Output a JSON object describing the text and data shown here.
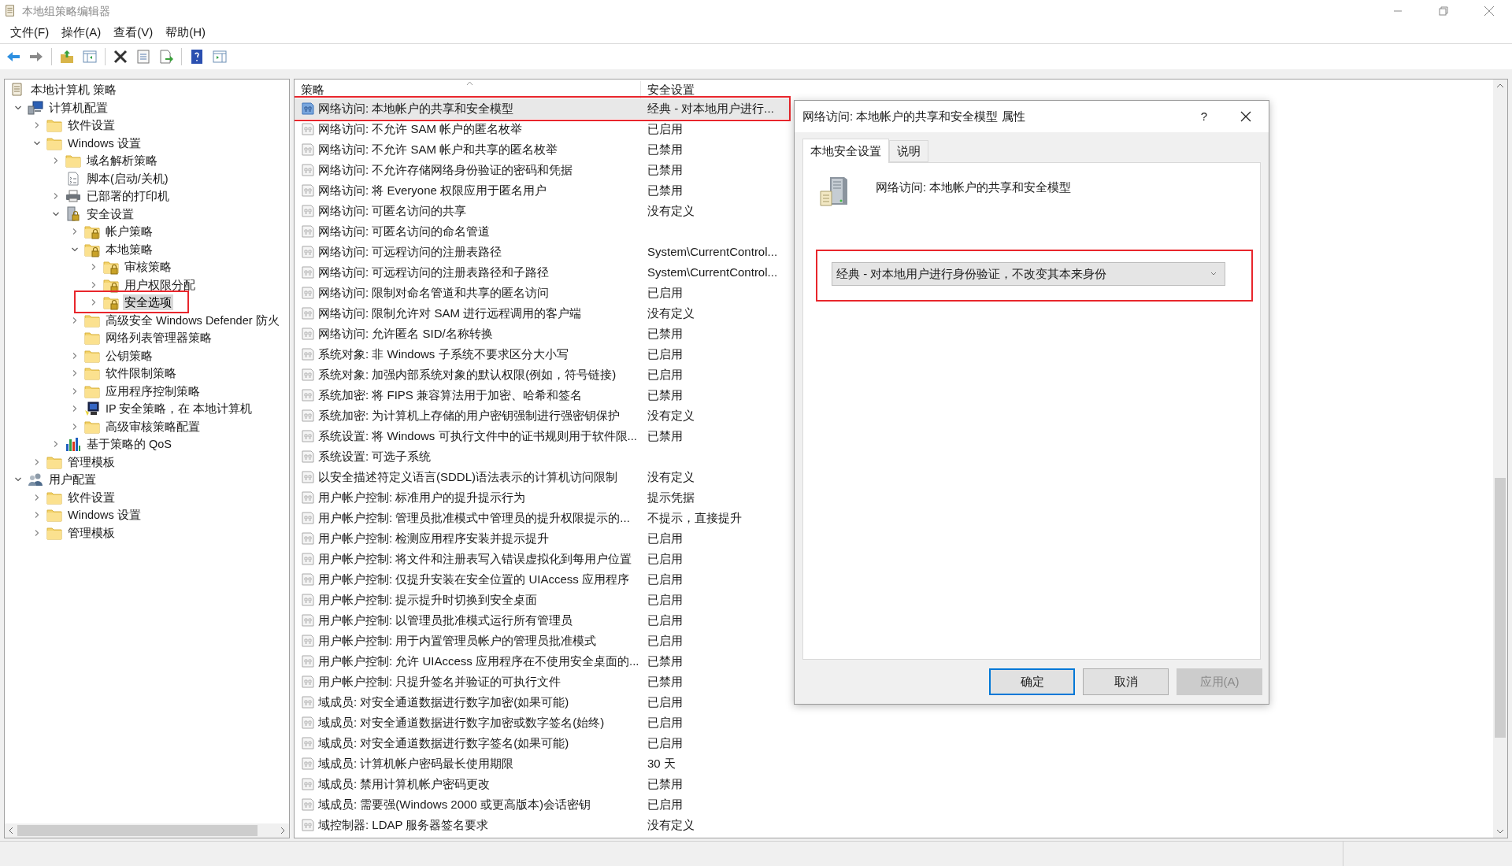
{
  "window": {
    "title": "本地组策略编辑器"
  },
  "menu": [
    "文件(F)",
    "操作(A)",
    "查看(V)",
    "帮助(H)"
  ],
  "tree": {
    "items": [
      {
        "label": "本地计算机 策略",
        "kind": "doc",
        "selected": false,
        "children": [
          {
            "label": "计算机配置",
            "kind": "computer",
            "expanded": true,
            "selected": false,
            "children": [
              {
                "label": "软件设置",
                "kind": "folder",
                "expanded": false,
                "selected": false
              },
              {
                "label": "Windows 设置",
                "kind": "folder",
                "expanded": true,
                "selected": false,
                "children": [
                  {
                    "label": "域名解析策略",
                    "kind": "folder",
                    "expanded": false,
                    "selected": false
                  },
                  {
                    "label": "脚本(启动/关机)",
                    "kind": "script",
                    "selected": false
                  },
                  {
                    "label": "已部署的打印机",
                    "kind": "printer",
                    "expanded": false,
                    "selected": false
                  },
                  {
                    "label": "安全设置",
                    "kind": "security",
                    "expanded": true,
                    "selected": false,
                    "children": [
                      {
                        "label": "帐户策略",
                        "kind": "lockfolder",
                        "expanded": false,
                        "selected": false
                      },
                      {
                        "label": "本地策略",
                        "kind": "lockfolder",
                        "expanded": true,
                        "selected": false,
                        "children": [
                          {
                            "label": "审核策略",
                            "kind": "lockfolder",
                            "expanded": false,
                            "selected": false
                          },
                          {
                            "label": "用户权限分配",
                            "kind": "lockfolder",
                            "expanded": false,
                            "selected": false
                          },
                          {
                            "label": "安全选项",
                            "kind": "lockfolder",
                            "expanded": false,
                            "selected": true,
                            "highlighted": true
                          }
                        ]
                      },
                      {
                        "label": "高级安全 Windows Defender 防火",
                        "kind": "folder",
                        "expanded": false,
                        "selected": false
                      },
                      {
                        "label": "网络列表管理器策略",
                        "kind": "folder",
                        "selected": false
                      },
                      {
                        "label": "公钥策略",
                        "kind": "folder",
                        "expanded": false,
                        "selected": false
                      },
                      {
                        "label": "软件限制策略",
                        "kind": "folder",
                        "expanded": false,
                        "selected": false
                      },
                      {
                        "label": "应用程序控制策略",
                        "kind": "folder",
                        "expanded": false,
                        "selected": false
                      },
                      {
                        "label": "IP 安全策略，在 本地计算机",
                        "kind": "ip",
                        "expanded": false,
                        "selected": false
                      },
                      {
                        "label": "高级审核策略配置",
                        "kind": "folder",
                        "expanded": false,
                        "selected": false
                      }
                    ]
                  },
                  {
                    "label": "基于策略的 QoS",
                    "kind": "qos",
                    "expanded": false,
                    "selected": false
                  }
                ]
              },
              {
                "label": "管理模板",
                "kind": "folder",
                "expanded": false,
                "selected": false
              }
            ]
          },
          {
            "label": "用户配置",
            "kind": "user",
            "expanded": true,
            "selected": false,
            "children": [
              {
                "label": "软件设置",
                "kind": "folder",
                "expanded": false,
                "selected": false
              },
              {
                "label": "Windows 设置",
                "kind": "folder",
                "expanded": false,
                "selected": false
              },
              {
                "label": "管理模板",
                "kind": "folder",
                "expanded": false,
                "selected": false
              }
            ]
          }
        ]
      }
    ]
  },
  "table": {
    "columns": [
      "策略",
      "安全设置"
    ],
    "rows": [
      {
        "policy": "网络访问: 本地帐户的共享和安全模型",
        "setting": "经典 - 对本地用户进行...",
        "selected": true,
        "highlighted": true
      },
      {
        "policy": "网络访问: 不允许 SAM 帐户的匿名枚举",
        "setting": "已启用",
        "selected": false
      },
      {
        "policy": "网络访问: 不允许 SAM 帐户和共享的匿名枚举",
        "setting": "已禁用",
        "selected": false
      },
      {
        "policy": "网络访问: 不允许存储网络身份验证的密码和凭据",
        "setting": "已禁用",
        "selected": false
      },
      {
        "policy": "网络访问: 将 Everyone 权限应用于匿名用户",
        "setting": "已禁用",
        "selected": false
      },
      {
        "policy": "网络访问: 可匿名访问的共享",
        "setting": "没有定义",
        "selected": false
      },
      {
        "policy": "网络访问: 可匿名访问的命名管道",
        "selected": false
      },
      {
        "policy": "网络访问: 可远程访问的注册表路径",
        "setting": "System\\CurrentControl...",
        "selected": false
      },
      {
        "policy": "网络访问: 可远程访问的注册表路径和子路径",
        "setting": "System\\CurrentControl...",
        "selected": false
      },
      {
        "policy": "网络访问: 限制对命名管道和共享的匿名访问",
        "setting": "已启用",
        "selected": false
      },
      {
        "policy": "网络访问: 限制允许对 SAM 进行远程调用的客户端",
        "setting": "没有定义",
        "selected": false
      },
      {
        "policy": "网络访问: 允许匿名 SID/名称转换",
        "setting": "已禁用",
        "selected": false
      },
      {
        "policy": "系统对象: 非 Windows 子系统不要求区分大小写",
        "setting": "已启用",
        "selected": false
      },
      {
        "policy": "系统对象: 加强内部系统对象的默认权限(例如，符号链接)",
        "setting": "已启用",
        "selected": false
      },
      {
        "policy": "系统加密: 将 FIPS 兼容算法用于加密、哈希和签名",
        "setting": "已禁用",
        "selected": false
      },
      {
        "policy": "系统加密: 为计算机上存储的用户密钥强制进行强密钥保护",
        "setting": "没有定义",
        "selected": false
      },
      {
        "policy": "系统设置: 将 Windows 可执行文件中的证书规则用于软件限...",
        "setting": "已禁用",
        "selected": false
      },
      {
        "policy": "系统设置: 可选子系统",
        "selected": false
      },
      {
        "policy": "以安全描述符定义语言(SDDL)语法表示的计算机访问限制",
        "setting": "没有定义",
        "selected": false
      },
      {
        "policy": "用户帐户控制: 标准用户的提升提示行为",
        "setting": "提示凭据",
        "selected": false
      },
      {
        "policy": "用户帐户控制: 管理员批准模式中管理员的提升权限提示的...",
        "setting": "不提示，直接提升",
        "selected": false
      },
      {
        "policy": "用户帐户控制: 检测应用程序安装并提示提升",
        "setting": "已启用",
        "selected": false
      },
      {
        "policy": "用户帐户控制: 将文件和注册表写入错误虚拟化到每用户位置",
        "setting": "已启用",
        "selected": false
      },
      {
        "policy": "用户帐户控制: 仅提升安装在安全位置的 UIAccess 应用程序",
        "setting": "已启用",
        "selected": false
      },
      {
        "policy": "用户帐户控制: 提示提升时切换到安全桌面",
        "setting": "已启用",
        "selected": false
      },
      {
        "policy": "用户帐户控制: 以管理员批准模式运行所有管理员",
        "setting": "已启用",
        "selected": false
      },
      {
        "policy": "用户帐户控制: 用于内置管理员帐户的管理员批准模式",
        "setting": "已启用",
        "selected": false
      },
      {
        "policy": "用户帐户控制: 允许 UIAccess 应用程序在不使用安全桌面的...",
        "setting": "已禁用",
        "selected": false
      },
      {
        "policy": "用户帐户控制: 只提升签名并验证的可执行文件",
        "setting": "已禁用",
        "selected": false
      },
      {
        "policy": "域成员: 对安全通道数据进行数字加密(如果可能)",
        "setting": "已启用",
        "selected": false
      },
      {
        "policy": "域成员: 对安全通道数据进行数字加密或数字签名(始终)",
        "setting": "已启用",
        "selected": false
      },
      {
        "policy": "域成员: 对安全通道数据进行数字签名(如果可能)",
        "setting": "已启用",
        "selected": false
      },
      {
        "policy": "域成员: 计算机帐户密码最长使用期限",
        "setting": "30 天",
        "selected": false
      },
      {
        "policy": "域成员: 禁用计算机帐户密码更改",
        "setting": "已禁用",
        "selected": false
      },
      {
        "policy": "域成员: 需要强(Windows 2000 或更高版本)会话密钥",
        "setting": "已启用",
        "selected": false
      },
      {
        "policy": "域控制器: LDAP 服务器签名要求",
        "setting": "没有定义",
        "selected": false
      }
    ]
  },
  "dialog": {
    "title": "网络访问: 本地帐户的共享和安全模型 属性",
    "help": "?",
    "tabs": [
      {
        "label": "本地安全设置",
        "selected": true
      },
      {
        "label": "说明",
        "selected": false
      }
    ],
    "policy_name": "网络访问: 本地帐户的共享和安全模型",
    "dropdown": {
      "value": "经典 - 对本地用户进行身份验证，不改变其本来身份",
      "highlighted": true
    },
    "buttons": [
      {
        "label": "确定",
        "default": true,
        "disabled": false
      },
      {
        "label": "取消",
        "default": false,
        "disabled": false
      },
      {
        "label": "应用(A)",
        "default": false,
        "disabled": true
      }
    ]
  }
}
